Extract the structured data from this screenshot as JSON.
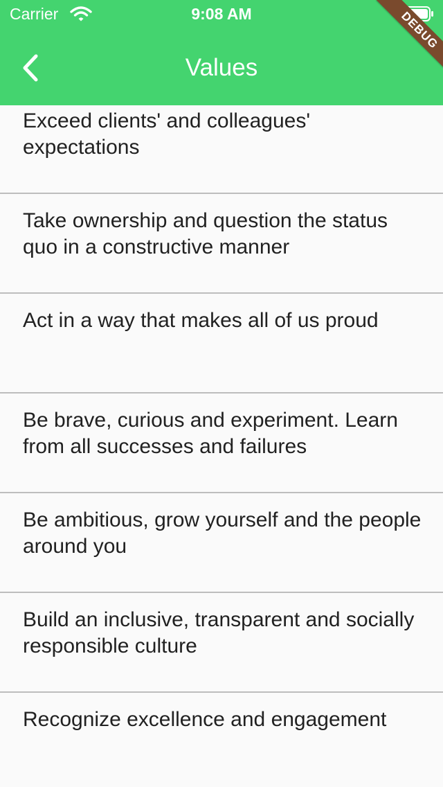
{
  "status_bar": {
    "carrier": "Carrier",
    "time": "9:08 AM"
  },
  "app_bar": {
    "title": "Values",
    "background_color": "#44d46f",
    "back_icon": "chevron-left-icon"
  },
  "debug_banner": {
    "label": "DEBUG",
    "color": "#7a4a2d"
  },
  "values": {
    "items": [
      {
        "text": "Exceed clients' and colleagues' expectations"
      },
      {
        "text": "Take ownership and question the status quo in a constructive manner"
      },
      {
        "text": "Act in a way that makes all of us proud"
      },
      {
        "text": "Be brave, curious and experiment. Learn from all successes and failures"
      },
      {
        "text": "Be ambitious, grow yourself and the people around you"
      },
      {
        "text": "Build an inclusive, transparent and socially responsible culture"
      },
      {
        "text": "Recognize excellence and engagement"
      }
    ]
  }
}
